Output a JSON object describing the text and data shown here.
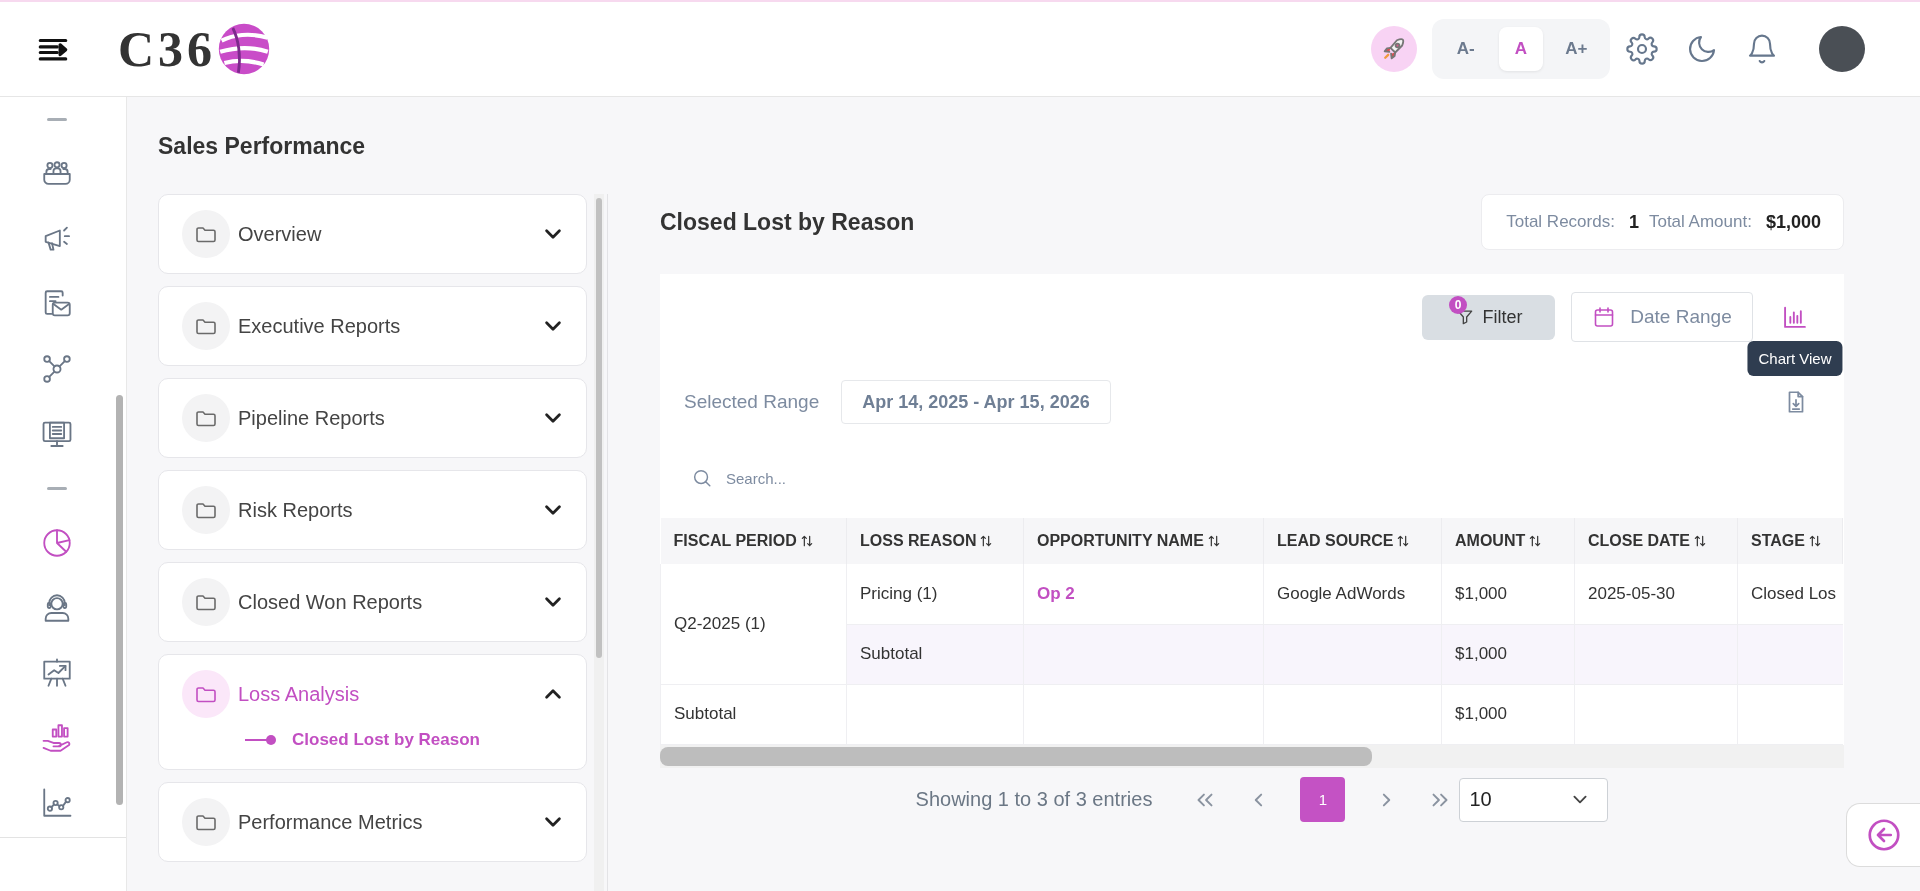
{
  "header": {
    "logo_text": "C36",
    "font_size_buttons": [
      {
        "label": "A-",
        "selected": false
      },
      {
        "label": "A",
        "selected": true
      },
      {
        "label": "A+",
        "selected": false
      }
    ]
  },
  "sidebar": {
    "items": [
      {
        "kind": "separator"
      },
      {
        "kind": "link",
        "active": false
      },
      {
        "kind": "link",
        "active": false
      },
      {
        "kind": "link",
        "active": false
      },
      {
        "kind": "link",
        "active": false
      },
      {
        "kind": "link",
        "active": false
      },
      {
        "kind": "separator"
      },
      {
        "kind": "link",
        "active": true
      },
      {
        "kind": "link",
        "active": false
      },
      {
        "kind": "link",
        "active": false
      },
      {
        "kind": "link",
        "active": true
      },
      {
        "kind": "link",
        "active": false
      }
    ]
  },
  "page_title": "Sales Performance",
  "report_groups": [
    {
      "label": "Overview",
      "active": false,
      "expanded": false
    },
    {
      "label": "Executive Reports",
      "active": false,
      "expanded": false
    },
    {
      "label": "Pipeline Reports",
      "active": false,
      "expanded": false
    },
    {
      "label": "Risk Reports",
      "active": false,
      "expanded": false
    },
    {
      "label": "Closed Won Reports",
      "active": false,
      "expanded": false
    },
    {
      "label": "Loss Analysis",
      "active": true,
      "expanded": true,
      "children": [
        {
          "label": "Closed Lost by Reason",
          "selected": true
        }
      ]
    },
    {
      "label": "Performance Metrics",
      "active": false,
      "expanded": false
    }
  ],
  "report": {
    "title": "Closed Lost by Reason",
    "summary": [
      {
        "label": "Total Records:",
        "value": "1"
      },
      {
        "label": "Total Amount:",
        "value": "$1,000"
      }
    ],
    "filter_button": {
      "label": "Filter",
      "count": "0"
    },
    "date_range_button": "Date Range",
    "tooltip": "Chart View",
    "selected_range": {
      "label": "Selected Range",
      "value": "Apr 14, 2025 - Apr 15, 2026"
    },
    "search": {
      "placeholder": "Search..."
    },
    "table": {
      "columns": [
        {
          "label": "FISCAL PERIOD",
          "kind": "text"
        },
        {
          "label": "LOSS REASON",
          "kind": "text"
        },
        {
          "label": "OPPORTUNITY NAME",
          "kind": "link"
        },
        {
          "label": "LEAD SOURCE",
          "kind": "text"
        },
        {
          "label": "AMOUNT",
          "kind": "text"
        },
        {
          "label": "CLOSE DATE",
          "kind": "text"
        },
        {
          "label": "STAGE",
          "kind": "text"
        }
      ],
      "groups": [
        {
          "fiscal_period": "Q2-2025 (1)",
          "rows": [
            {
              "kind": "detail",
              "cells": [
                "Pricing (1)",
                "Op 2",
                "Google AdWords",
                "$1,000",
                "2025-05-30",
                "Closed Los"
              ]
            },
            {
              "kind": "subtotal",
              "cells": [
                "Subtotal",
                null,
                null,
                "$1,000",
                null,
                null
              ]
            }
          ]
        }
      ],
      "total": {
        "cells": [
          "Subtotal",
          null,
          null,
          null,
          "$1,000",
          null,
          null
        ]
      }
    },
    "pagination": {
      "summary": "Showing 1 to 3 of 3 entries",
      "pages": [
        {
          "label": "1",
          "selected": true
        }
      ],
      "page_size": "10"
    }
  }
}
